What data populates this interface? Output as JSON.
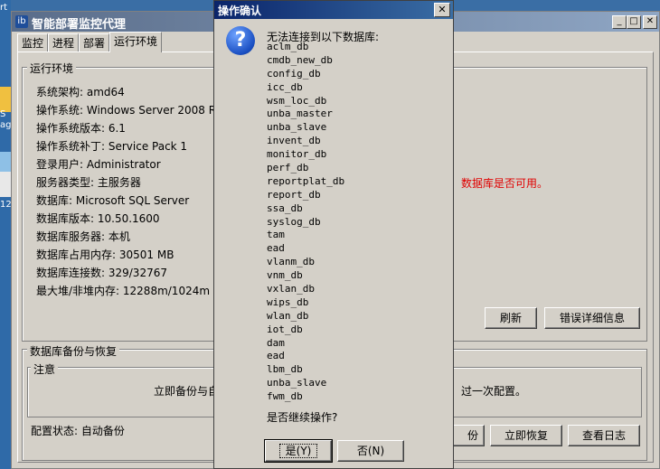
{
  "desktop": {
    "texts": [
      "rt",
      "S",
      "ag",
      "12"
    ]
  },
  "main_window": {
    "title": "智能部署监控代理",
    "caption_buttons": {
      "minimize": "_",
      "maximize": "□",
      "close": "✕"
    },
    "tabs": [
      "监控",
      "进程",
      "部署",
      "运行环境"
    ],
    "runtime_group": {
      "legend": "运行环境",
      "lines": [
        "系统架构: amd64",
        "操作系统: Windows Server 2008 R2",
        "操作系统版本: 6.1",
        "操作系统补丁: Service Pack 1",
        "登录用户: Administrator",
        "服务器类型: 主服务器",
        "数据库: Microsoft SQL Server",
        "数据库版本: 10.50.1600",
        "数据库服务器: 本机",
        "数据库占用内存: 30501 MB",
        "数据库连接数: 329/32767",
        "最大堆/非堆内存: 12288m/1024m"
      ],
      "error_text": "数据库是否可用。",
      "refresh_button": "刷新",
      "error_detail_button": "错误详细信息"
    },
    "backup_group": {
      "legend": "数据库备份与恢复",
      "note_legend": "注意",
      "note_left": "立即备份与自",
      "note_right": "过一次配置。",
      "config_status": "配置状态: 自动备份",
      "backup_button_partial": "份",
      "restore_button": "立即恢复",
      "log_button": "查看日志"
    }
  },
  "dialog": {
    "title": "操作确认",
    "close": "✕",
    "icon": "question-icon",
    "message": "无法连接到以下数据库:",
    "databases": [
      "aclm_db",
      "cmdb_new_db",
      "config_db",
      "icc_db",
      "wsm_loc_db",
      "unba_master",
      "unba_slave",
      "invent_db",
      "monitor_db",
      "perf_db",
      "reportplat_db",
      "report_db",
      "ssa_db",
      "syslog_db",
      "tam",
      "ead",
      "vlanm_db",
      "vnm_db",
      "vxlan_db",
      "wips_db",
      "wlan_db",
      "iot_db",
      "dam",
      "ead",
      "lbm_db",
      "unba_slave",
      "fwm_db"
    ],
    "question": "是否继续操作?",
    "yes_button": "是(Y)",
    "no_button": "否(N)"
  },
  "colors": {
    "error_red": "#e00000",
    "dialog_title": "#0a246a",
    "window_bg": "#d4d0c8",
    "desktop": "#3a6ea5"
  }
}
